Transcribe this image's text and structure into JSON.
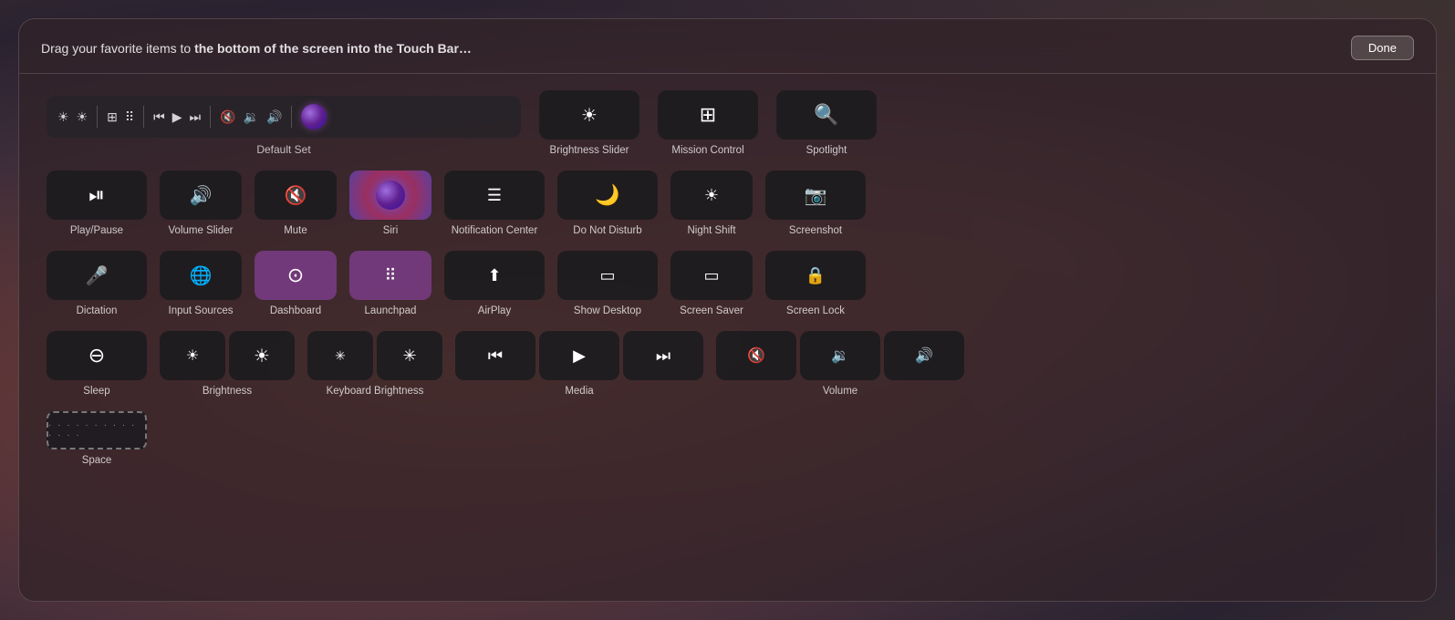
{
  "header": {
    "instruction": "Drag your favorite items to the bottom of the screen into the Touch Bar...",
    "done_label": "Done"
  },
  "default_set": {
    "label": "Default Set"
  },
  "items": {
    "row1": [
      {
        "id": "brightness-slider",
        "label": "Brightness Slider",
        "icon": "☀"
      },
      {
        "id": "mission-control",
        "label": "Mission Control",
        "icon": "⊞"
      },
      {
        "id": "spotlight",
        "label": "Spotlight",
        "icon": "🔍"
      }
    ],
    "row2": [
      {
        "id": "play-pause",
        "label": "Play/Pause",
        "icon": "⏯"
      },
      {
        "id": "volume-slider",
        "label": "Volume Slider",
        "icon": "🔊"
      },
      {
        "id": "mute",
        "label": "Mute",
        "icon": "🔇"
      },
      {
        "id": "siri",
        "label": "Siri",
        "icon": "siri"
      },
      {
        "id": "notification-center",
        "label": "Notification Center",
        "icon": "≡"
      },
      {
        "id": "do-not-disturb",
        "label": "Do Not Disturb",
        "icon": "🌙"
      },
      {
        "id": "night-shift",
        "label": "Night Shift",
        "icon": "☀"
      },
      {
        "id": "screenshot",
        "label": "Screenshot",
        "icon": "📷"
      }
    ],
    "row3": [
      {
        "id": "dictation",
        "label": "Dictation",
        "icon": "🎤"
      },
      {
        "id": "input-sources",
        "label": "Input Sources",
        "icon": "🌐"
      },
      {
        "id": "dashboard",
        "label": "Dashboard",
        "icon": "⊙",
        "purple": true
      },
      {
        "id": "launchpad",
        "label": "Launchpad",
        "icon": "⊞",
        "purple": true
      },
      {
        "id": "airplay",
        "label": "AirPlay",
        "icon": "▲"
      },
      {
        "id": "show-desktop",
        "label": "Show Desktop",
        "icon": "▭"
      },
      {
        "id": "screen-saver",
        "label": "Screen Saver",
        "icon": "▭"
      },
      {
        "id": "screen-lock",
        "label": "Screen Lock",
        "icon": "🔒"
      }
    ],
    "row4": [
      {
        "id": "sleep",
        "label": "Sleep",
        "icon": "⊖"
      },
      {
        "id": "brightness-group",
        "label": "Brightness",
        "icons": [
          "☀",
          "☀"
        ]
      },
      {
        "id": "keyboard-brightness-group",
        "label": "Keyboard Brightness",
        "icons": [
          "✳",
          "✳"
        ]
      },
      {
        "id": "media-group",
        "label": "Media",
        "icons": [
          "⏮",
          "▶",
          "⏭"
        ]
      },
      {
        "id": "volume-group",
        "label": "Volume",
        "icons": [
          "🔇",
          "🔉",
          "🔊"
        ]
      }
    ],
    "row5": [
      {
        "id": "space",
        "label": "Space"
      }
    ]
  }
}
